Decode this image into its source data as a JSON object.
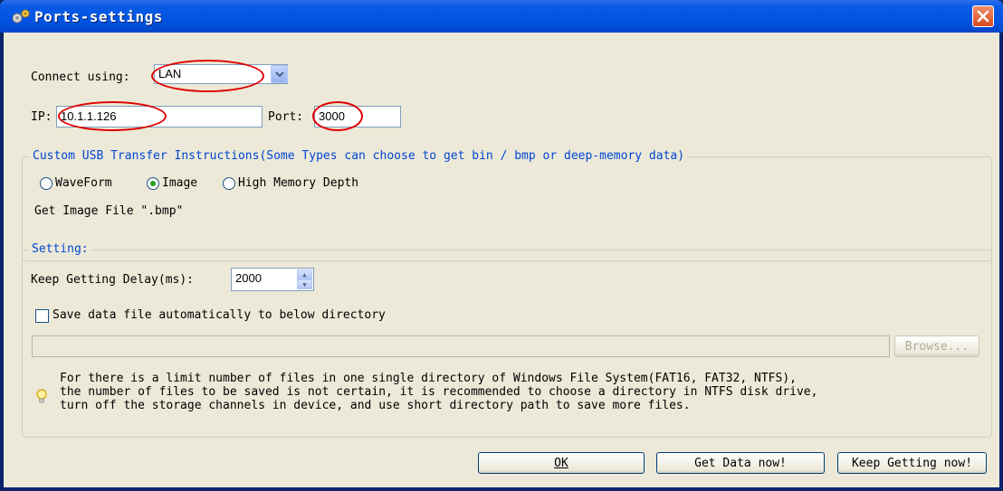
{
  "window": {
    "title": "Ports-settings"
  },
  "connect": {
    "label": "Connect using:",
    "value": "LAN"
  },
  "ip": {
    "label": "IP:",
    "value": "10.1.1.126"
  },
  "port": {
    "label": "Port:",
    "value": "3000"
  },
  "usb_group": {
    "legend": "Custom USB Transfer Instructions(Some Types can choose to get bin / bmp or deep-memory data)",
    "options": [
      "WaveForm",
      "Image",
      "High Memory Depth"
    ],
    "selected": "Image",
    "info": "Get Image File \".bmp\""
  },
  "setting_group": {
    "legend": "Setting:",
    "delay_label": "Keep Getting Delay(ms):",
    "delay_value": "2000",
    "save_label": "Save data file automatically to below directory",
    "save_checked": false,
    "path_value": "",
    "browse_label": "Browse...",
    "note_lines": [
      "For there is a limit number of files in one single directory of Windows File System(FAT16, FAT32, NTFS),",
      "the number of  files to be saved is not certain,  it is recommended to choose a directory in NTFS disk drive,",
      "turn off the storage channels in device, and use short directory path to save more files."
    ]
  },
  "buttons": {
    "ok": "OK",
    "get_data": "Get Data now!",
    "keep_getting": "Keep Getting now!"
  },
  "colors": {
    "title_bar": "#0054e3",
    "group_legend": "#0046d5",
    "annotation": "#e00000"
  }
}
